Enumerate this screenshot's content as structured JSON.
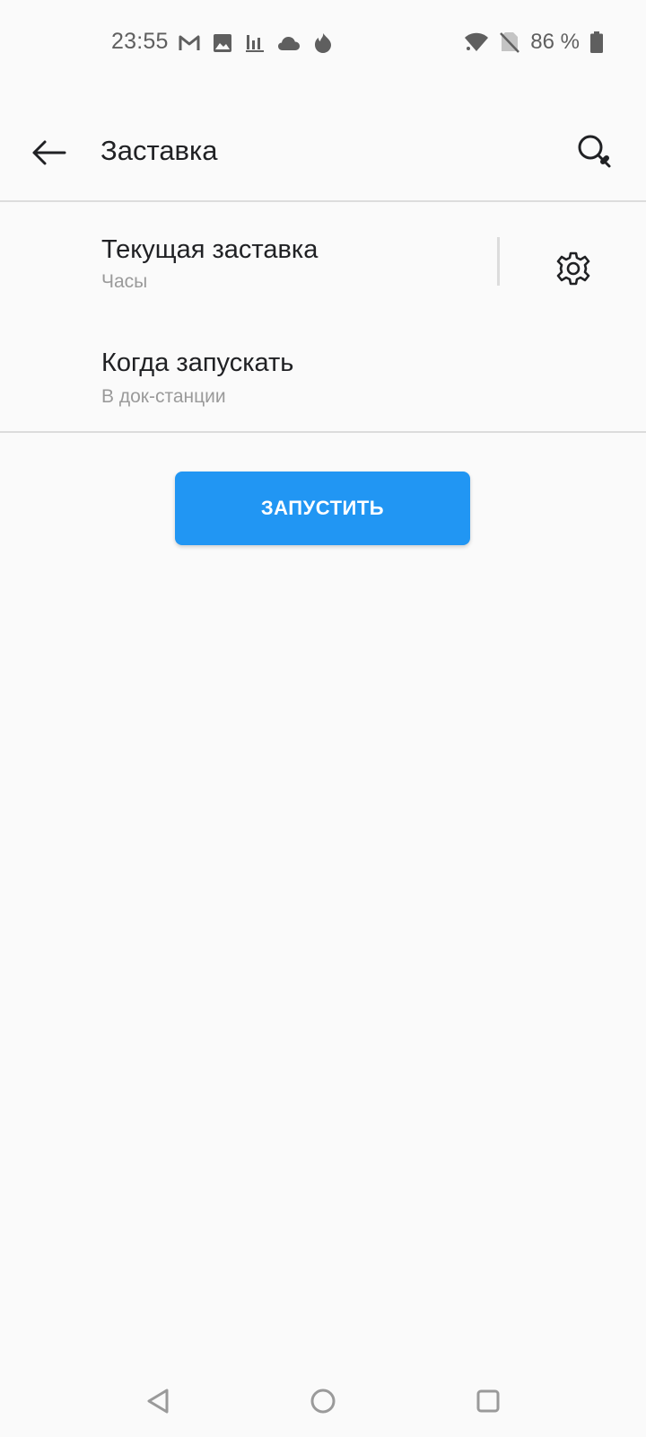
{
  "status_bar": {
    "time": "23:55",
    "battery_text": "86 %",
    "icons_left": [
      "gmail-icon",
      "image-icon",
      "bar-chart-icon",
      "cloud-icon",
      "fire-icon"
    ],
    "icons_right": [
      "wifi-icon",
      "no-sim-icon",
      "battery-icon"
    ]
  },
  "toolbar": {
    "title": "Заставка",
    "back_icon": "arrow-left-icon",
    "search_icon": "search-icon"
  },
  "settings": {
    "items": [
      {
        "title": "Текущая заставка",
        "subtitle": "Часы",
        "action_icon": "gear-icon"
      },
      {
        "title": "Когда запускать",
        "subtitle": "В док-станции"
      }
    ]
  },
  "actions": {
    "start_label": "ЗАПУСТИТЬ",
    "start_color": "#2196f3"
  },
  "nav_bar": {
    "buttons": [
      "nav-back-icon",
      "nav-home-icon",
      "nav-recents-icon"
    ]
  }
}
